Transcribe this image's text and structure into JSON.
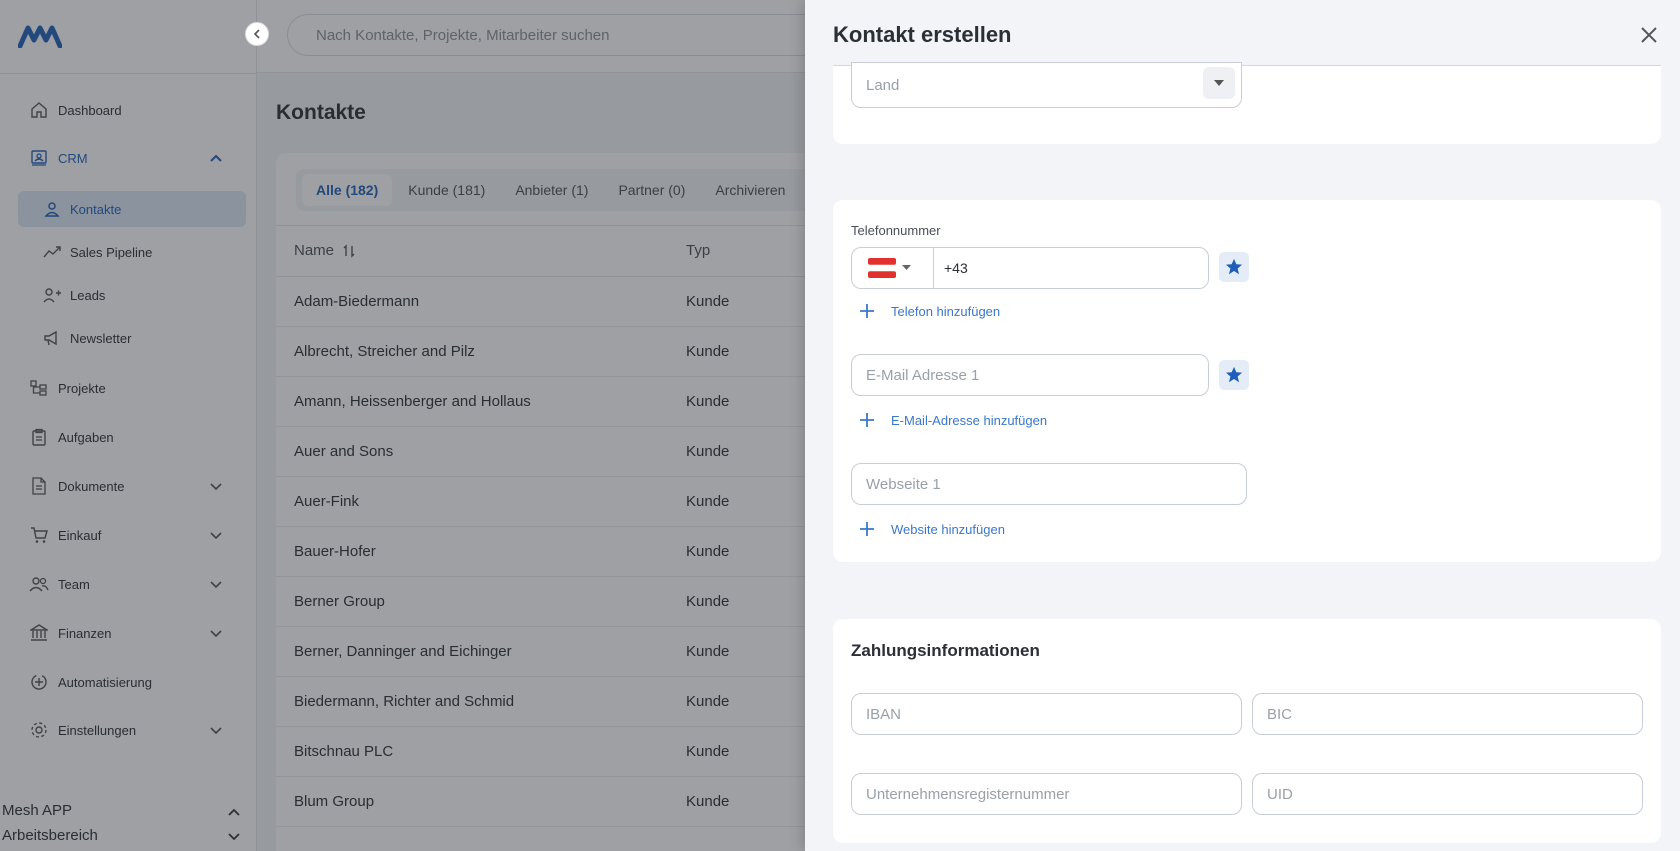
{
  "colors": {
    "brand": "#1f5fb8",
    "link": "#3a78c9",
    "active_bg": "#dde8f6",
    "flag_red": "#e0312f"
  },
  "search": {
    "placeholder": "Nach Kontakte, Projekte, Mitarbeiter suchen"
  },
  "sidebar": {
    "items": [
      {
        "label": "Dashboard",
        "icon": "home-icon"
      },
      {
        "label": "CRM",
        "icon": "crm-icon"
      },
      {
        "label": "Kontakte",
        "icon": "person-icon"
      },
      {
        "label": "Sales Pipeline",
        "icon": "trend-icon"
      },
      {
        "label": "Leads",
        "icon": "user-plus-icon"
      },
      {
        "label": "Newsletter",
        "icon": "megaphone-icon"
      },
      {
        "label": "Projekte",
        "icon": "projects-icon"
      },
      {
        "label": "Aufgaben",
        "icon": "clipboard-icon"
      },
      {
        "label": "Dokumente",
        "icon": "document-icon"
      },
      {
        "label": "Einkauf",
        "icon": "cart-icon"
      },
      {
        "label": "Team",
        "icon": "team-icon"
      },
      {
        "label": "Finanzen",
        "icon": "bank-icon"
      },
      {
        "label": "Automatisierung",
        "icon": "automation-icon"
      },
      {
        "label": "Einstellungen",
        "icon": "gear-icon"
      }
    ],
    "workspace_app": "Mesh APP",
    "workspace_label": "Arbeitsbereich"
  },
  "main": {
    "title": "Kontakte",
    "tabs": [
      "Alle (182)",
      "Kunde (181)",
      "Anbieter (1)",
      "Partner (0)",
      "Archivieren"
    ],
    "columns": [
      "Name",
      "Typ"
    ],
    "rows": [
      [
        "Adam-Biedermann",
        "Kunde"
      ],
      [
        "Albrecht, Streicher and Pilz",
        "Kunde"
      ],
      [
        "Amann, Heissenberger and Hollaus",
        "Kunde"
      ],
      [
        "Auer and Sons",
        "Kunde"
      ],
      [
        "Auer-Fink",
        "Kunde"
      ],
      [
        "Bauer-Hofer",
        "Kunde"
      ],
      [
        "Berner Group",
        "Kunde"
      ],
      [
        "Berner, Danninger and Eichinger",
        "Kunde"
      ],
      [
        "Biedermann, Richter and Schmid",
        "Kunde"
      ],
      [
        "Bitschnau PLC",
        "Kunde"
      ],
      [
        "Blum Group",
        "Kunde"
      ]
    ]
  },
  "drawer": {
    "title": "Kontakt erstellen",
    "land_placeholder": "Land",
    "phone_label": "Telefonnummer",
    "phone_value": "+43",
    "add_phone": "Telefon hinzufügen",
    "email_placeholder": "E-Mail Adresse 1",
    "add_email": "E-Mail-Adresse hinzufügen",
    "website_placeholder": "Webseite 1",
    "add_website": "Website hinzufügen",
    "payment_title": "Zahlungsinformationen",
    "iban_placeholder": "IBAN",
    "bic_placeholder": "BIC",
    "register_placeholder": "Unternehmensregisternummer",
    "uid_placeholder": "UID"
  }
}
